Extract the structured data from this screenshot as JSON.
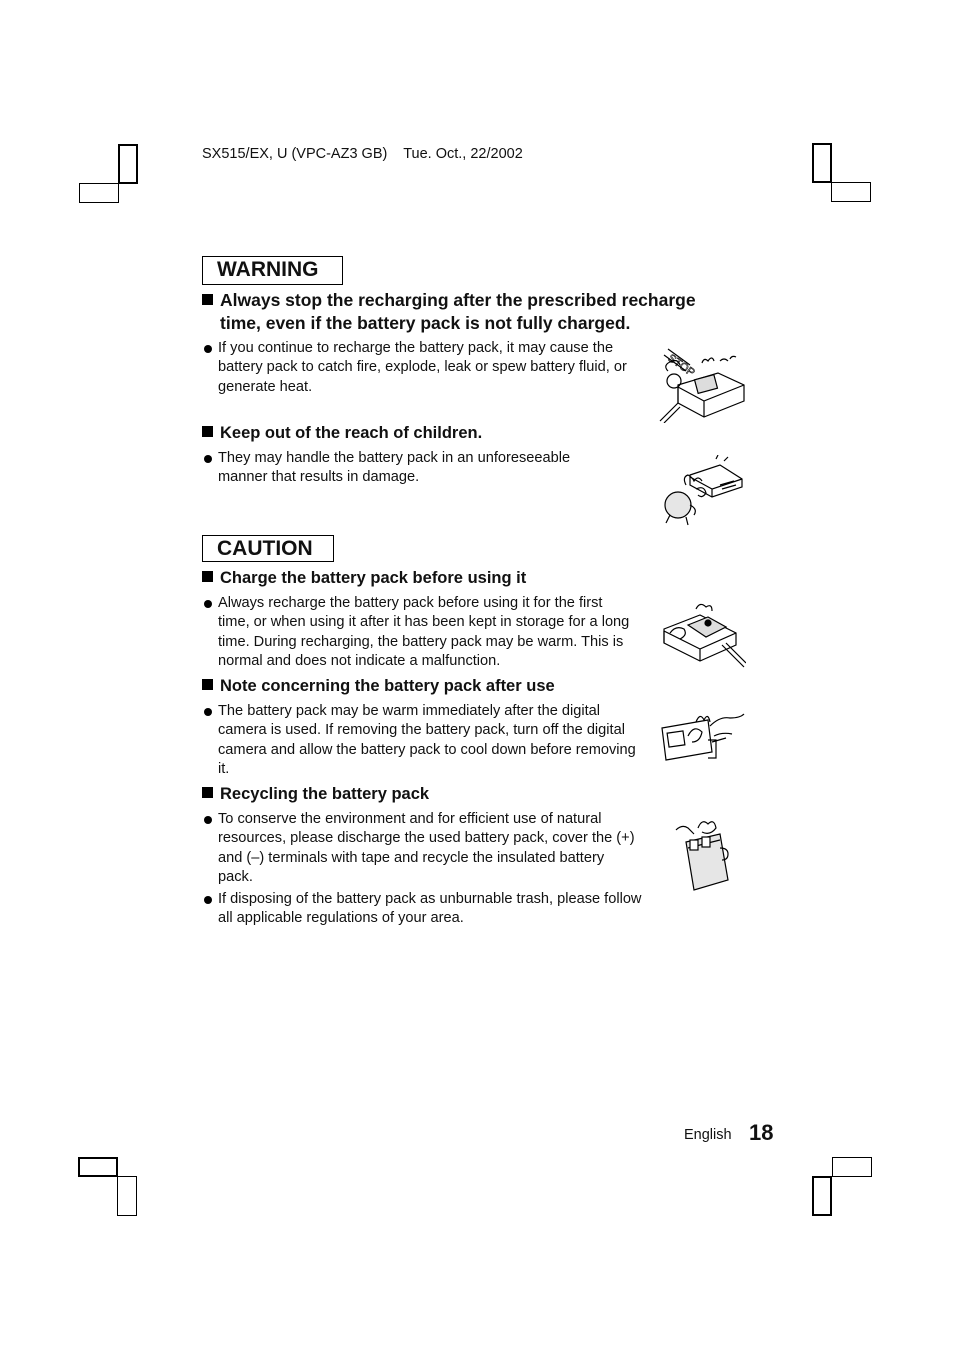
{
  "header": {
    "model": "SX515/EX, U (VPC-AZ3 GB)",
    "date": "Tue. Oct., 22/2002"
  },
  "warning": {
    "label": "WARNING",
    "items": [
      {
        "heading_line1": "Always stop the recharging after the prescribed recharge",
        "heading_line2": "time, even if the battery pack is not fully charged.",
        "bullets": [
          "If you continue to recharge the battery pack, it may cause the battery pack to catch fire, explode, leak or spew battery fluid, or generate heat."
        ],
        "illustration": "stop-charging-illustration"
      },
      {
        "heading": "Keep out of the reach of children.",
        "bullets": [
          "They may handle the battery pack in an unforeseeable manner that results in damage."
        ],
        "illustration": "child-with-charger-illustration"
      }
    ]
  },
  "caution": {
    "label": "CAUTION",
    "items": [
      {
        "heading": "Charge the battery pack before using it",
        "bullets": [
          "Always recharge the battery pack before using it for the first time, or when using it after it has been kept in storage for a long time. During recharging, the battery pack may be warm. This is normal and does not indicate a malfunction."
        ],
        "illustration": "charger-illustration"
      },
      {
        "heading": "Note concerning the battery pack after use",
        "bullets": [
          "The battery pack may be warm immediately after the digital camera is used. If removing the battery pack, turn off the digital camera and allow the battery pack to cool down before removing it."
        ],
        "illustration": "warm-camera-illustration"
      },
      {
        "heading": "Recycling the battery pack",
        "bullets": [
          "To conserve the environment and for efficient use of natural resources, please discharge the used battery pack, cover the (+) and (–) terminals with tape and recycle the insulated battery pack.",
          "If disposing of the battery pack as unburnable trash, please follow all applicable regulations of your area."
        ],
        "illustration": "battery-character-illustration"
      }
    ]
  },
  "footer": {
    "language": "English",
    "page_number": "18"
  }
}
